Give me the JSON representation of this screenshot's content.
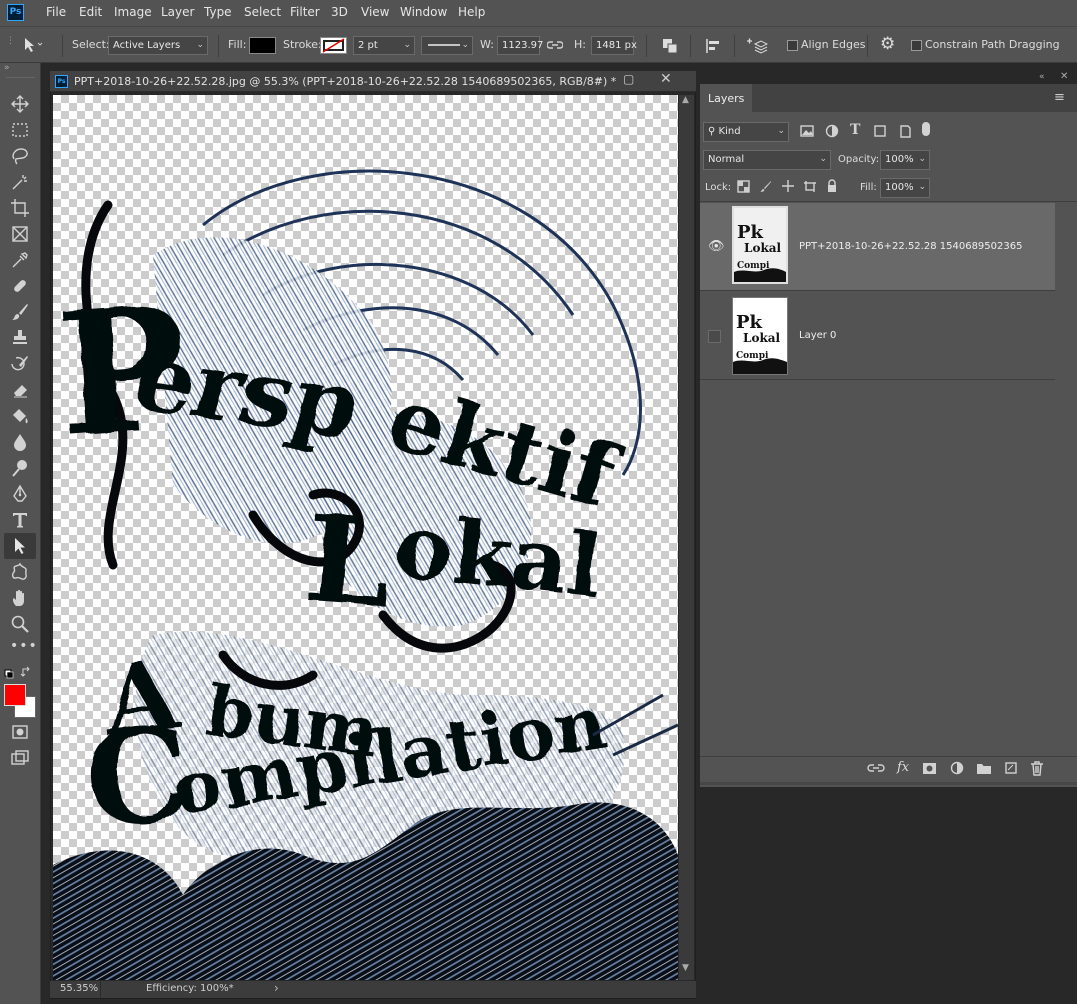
{
  "app": {
    "logo": "Ps",
    "accent": "#31a8ff"
  },
  "menu": [
    "File",
    "Edit",
    "Image",
    "Layer",
    "Type",
    "Select",
    "Filter",
    "3D",
    "View",
    "Window",
    "Help"
  ],
  "options": {
    "select_label": "Select:",
    "select_value": "Active Layers",
    "fill_label": "Fill:",
    "fill_color": "#000000",
    "stroke_label": "Stroke:",
    "stroke_width": "2 pt",
    "w_label": "W:",
    "w_value": "1123.97",
    "h_label": "H:",
    "h_value": "1481 px",
    "align_edges": "Align Edges",
    "constrain": "Constrain Path Dragging"
  },
  "document": {
    "title": "PPT+2018-10-26+22.52.28.jpg @ 55.3% (PPT+2018-10-26+22.52.28 1540689502365, RGB/8#) *",
    "zoom": "55.35%",
    "efficiency": "Efficiency: 100%*"
  },
  "artwork_text": {
    "line1": "Perspektif",
    "line2": "Lokal",
    "line3": "Album",
    "line4": "Compilation"
  },
  "layers_panel": {
    "tab": "Layers",
    "kind": "Kind",
    "blend_mode": "Normal",
    "opacity_label": "Opacity:",
    "opacity": "100%",
    "lock_label": "Lock:",
    "fill_label": "Fill:",
    "fill": "100%",
    "layers": [
      {
        "name": "PPT+2018-10-26+22.52.28  1540689502365",
        "visible": true,
        "selected": true
      },
      {
        "name": "Layer 0",
        "visible": false,
        "selected": false
      }
    ]
  },
  "colors": {
    "foreground": "#ff0000",
    "background": "#ffffff"
  }
}
